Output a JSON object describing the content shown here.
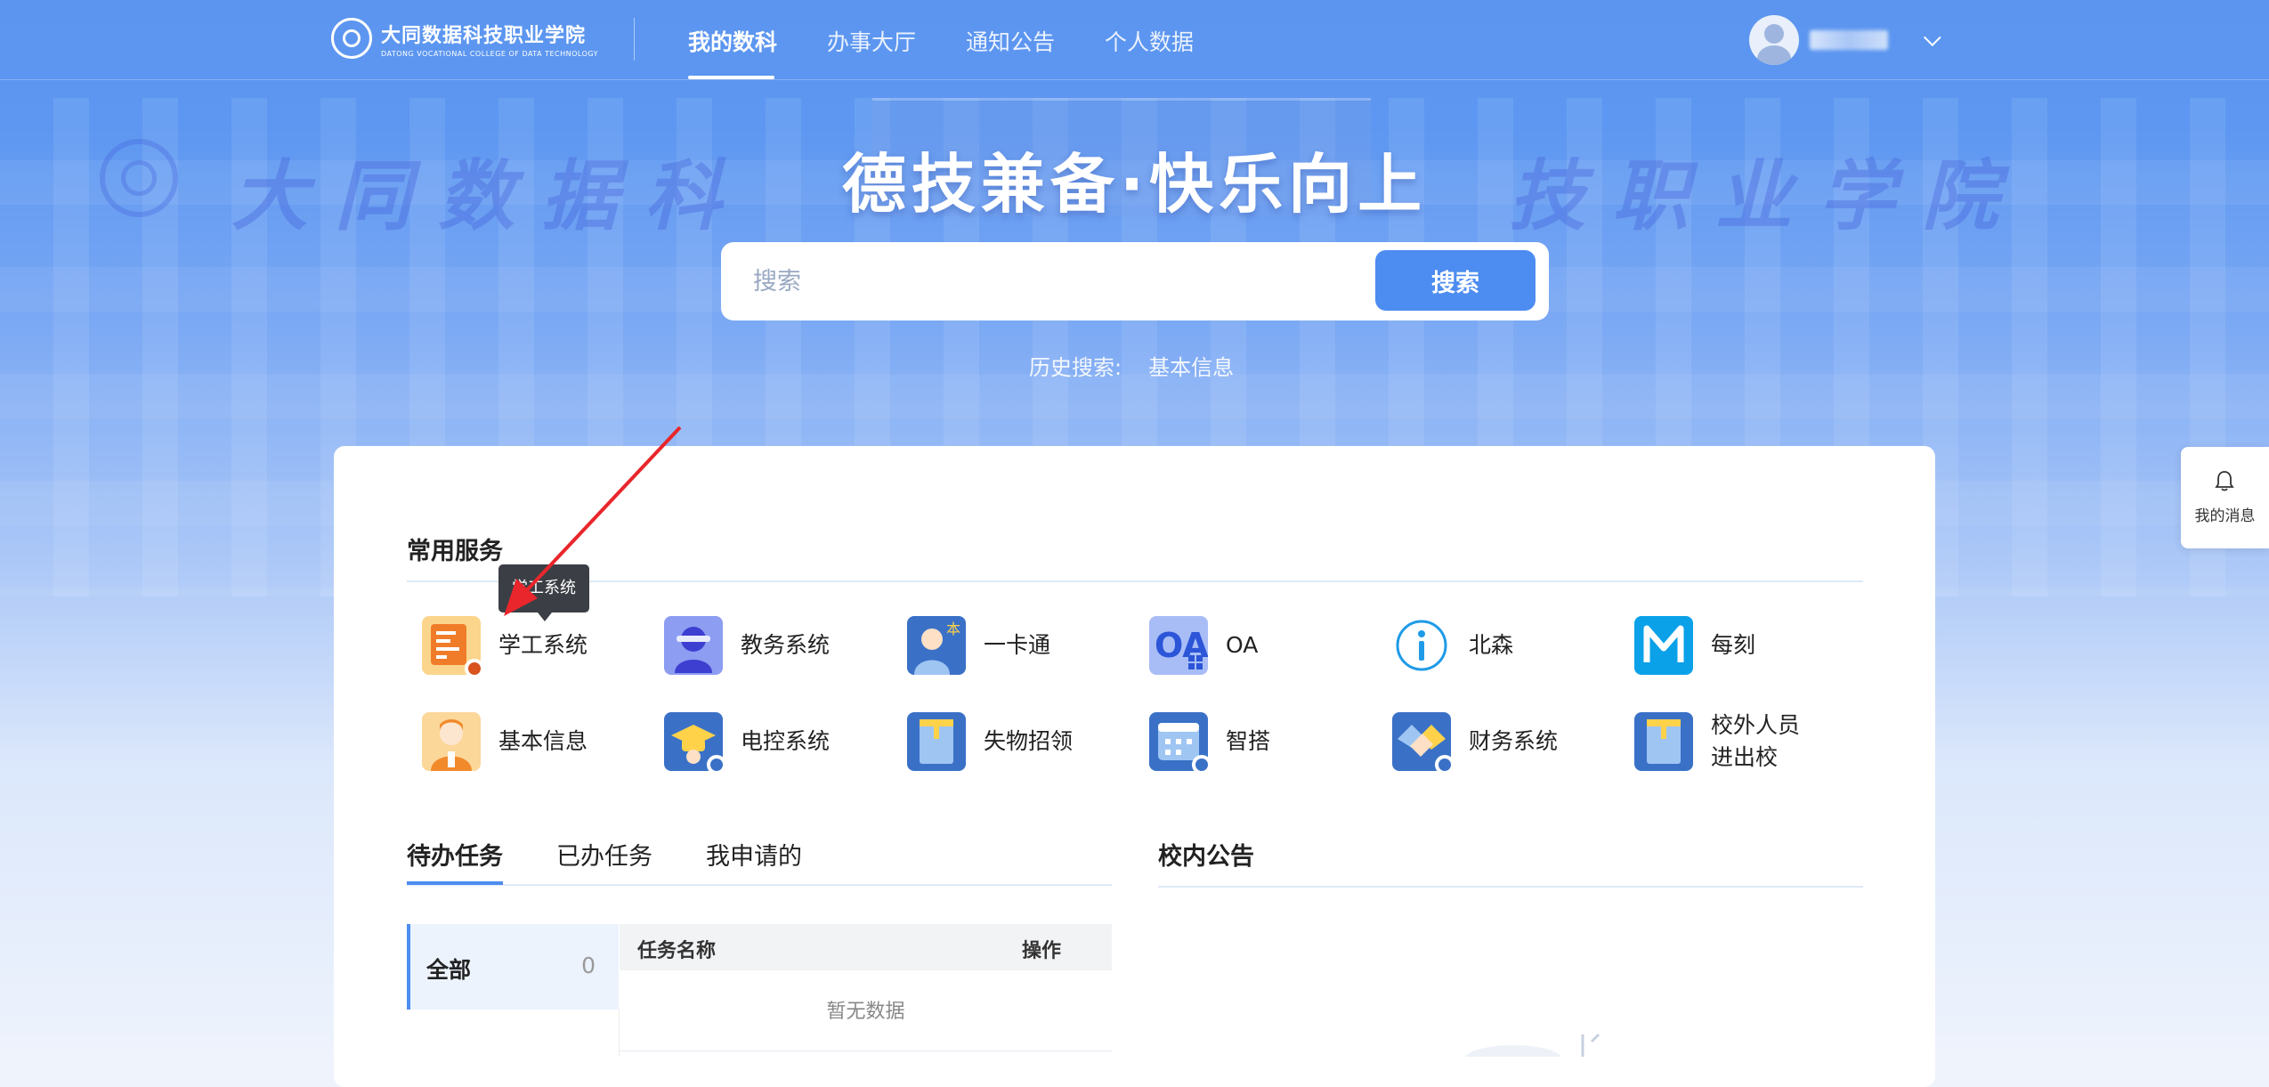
{
  "header": {
    "logo_cn": "大同数据科技职业学院",
    "logo_en": "DATONG VOCATIONAL COLLEGE OF DATA TECHNOLOGY",
    "nav": [
      {
        "label": "我的数科",
        "active": true
      },
      {
        "label": "办事大厅",
        "active": false
      },
      {
        "label": "通知公告",
        "active": false
      },
      {
        "label": "个人数据",
        "active": false
      }
    ],
    "user_name": "■■■■■"
  },
  "hero": {
    "watermark_left": "大同数据科",
    "watermark_right": "技职业学院",
    "slogan": "德技兼备·快乐向上"
  },
  "search": {
    "placeholder": "搜索",
    "button_label": "搜索",
    "history_label": "历史搜索:",
    "history_items": [
      "基本信息"
    ]
  },
  "services": {
    "title": "常用服务",
    "tooltip": "学工系统",
    "items": [
      {
        "label": "学工系统",
        "icon": "student-affairs-icon"
      },
      {
        "label": "教务系统",
        "icon": "academic-affairs-icon"
      },
      {
        "label": "一卡通",
        "icon": "campus-card-icon"
      },
      {
        "label": "OA",
        "icon": "oa-icon"
      },
      {
        "label": "北森",
        "icon": "beisen-info-icon"
      },
      {
        "label": "每刻",
        "icon": "meike-logo-icon"
      },
      {
        "label": "基本信息",
        "icon": "basic-info-icon"
      },
      {
        "label": "电控系统",
        "icon": "electric-control-icon"
      },
      {
        "label": "失物招领",
        "icon": "lost-found-icon"
      },
      {
        "label": "智搭",
        "icon": "zhida-icon"
      },
      {
        "label": "财务系统",
        "icon": "finance-icon"
      },
      {
        "label": "校外人员\n进出校",
        "icon": "visitor-access-icon"
      }
    ]
  },
  "tasks": {
    "tabs": [
      {
        "label": "待办任务",
        "active": true
      },
      {
        "label": "已办任务",
        "active": false
      },
      {
        "label": "我申请的",
        "active": false
      }
    ],
    "filter_label": "全部",
    "filter_count": "0",
    "columns": [
      "任务名称",
      "操作"
    ],
    "empty_text": "暂无数据"
  },
  "notices": {
    "title": "校内公告"
  },
  "float": {
    "message_label": "我的消息"
  },
  "colors": {
    "primary": "#4d8cf0",
    "hero_top": "#5b95ef",
    "annotation_arrow": "#e8262b"
  }
}
